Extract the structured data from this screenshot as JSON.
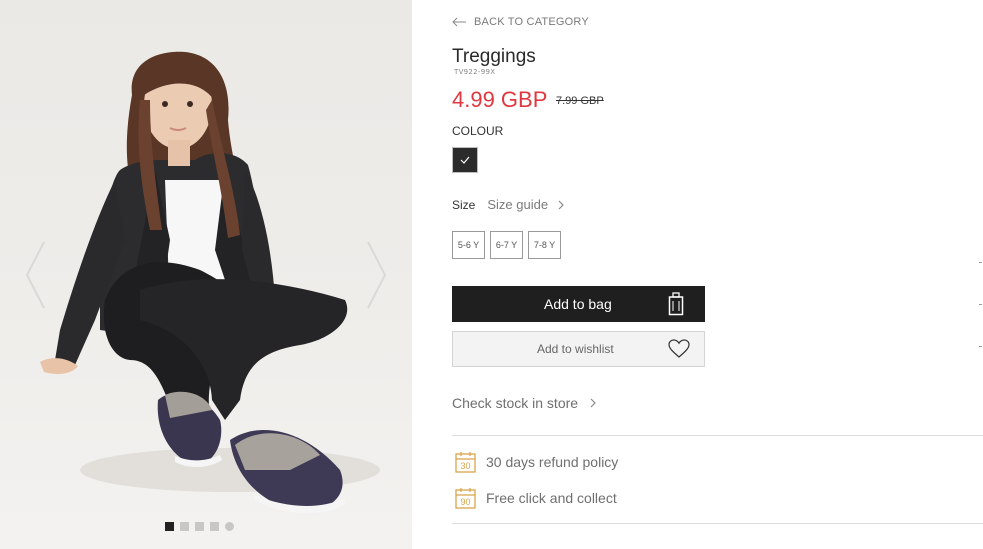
{
  "nav": {
    "back_label": "BACK TO CATEGORY"
  },
  "product": {
    "title": "Treggings",
    "sku": "TV922-99X",
    "price": "4.99 GBP",
    "old_price": "7.99 GBP"
  },
  "colour": {
    "label": "COLOUR",
    "selected_color": "#2b2b2b"
  },
  "size": {
    "label": "Size",
    "guide_label": "Size guide",
    "options": [
      "5-6 Y",
      "6-7 Y",
      "7-8 Y"
    ]
  },
  "actions": {
    "add_to_bag": "Add to bag",
    "add_to_wishlist": "Add to wishlist",
    "check_stock": "Check stock in store"
  },
  "policies": [
    {
      "icon": "calendar-30-icon",
      "badge": "30",
      "label": "30 days refund policy"
    },
    {
      "icon": "calendar-90-icon",
      "badge": "90",
      "label": "Free click and collect"
    }
  ],
  "gallery": {
    "image_count": 5,
    "active_index": 0
  },
  "colors": {
    "price_red": "#e0383e",
    "button_dark": "#1f1f1f",
    "policy_gold": "#d8a54a"
  }
}
